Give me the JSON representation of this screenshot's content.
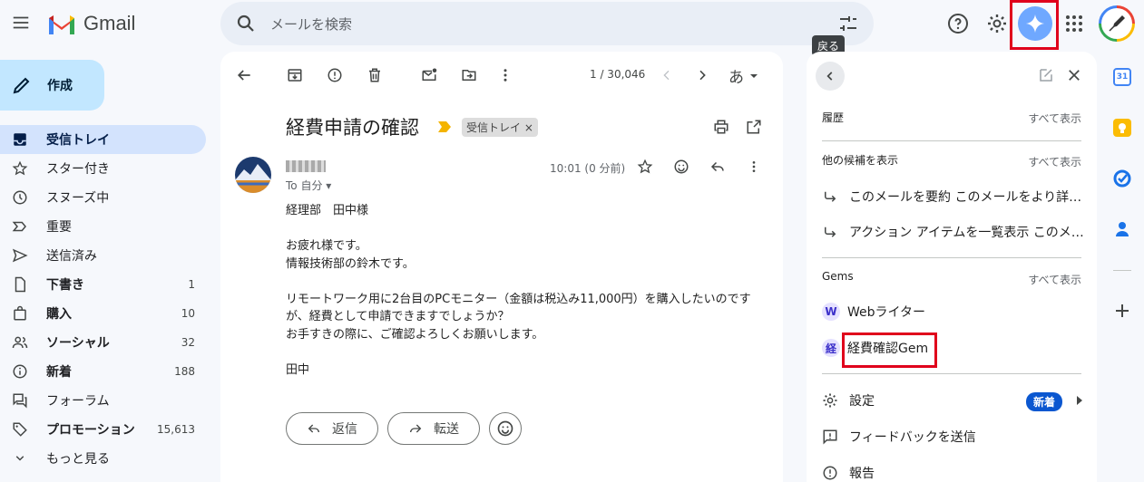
{
  "header": {
    "app_name": "Gmail",
    "search_placeholder": "メールを検索",
    "tooltip": "戻る"
  },
  "sidebar": {
    "compose_label": "作成",
    "items": [
      {
        "label": "受信トレイ",
        "count": "",
        "icon": "inbox-icon"
      },
      {
        "label": "スター付き",
        "count": "",
        "icon": "star-icon"
      },
      {
        "label": "スヌーズ中",
        "count": "",
        "icon": "clock-icon"
      },
      {
        "label": "重要",
        "count": "",
        "icon": "important-icon"
      },
      {
        "label": "送信済み",
        "count": "",
        "icon": "send-icon"
      },
      {
        "label": "下書き",
        "count": "1",
        "icon": "draft-icon"
      },
      {
        "label": "購入",
        "count": "10",
        "icon": "bag-icon"
      },
      {
        "label": "ソーシャル",
        "count": "32",
        "icon": "people-icon"
      },
      {
        "label": "新着",
        "count": "188",
        "icon": "info-icon"
      },
      {
        "label": "フォーラム",
        "count": "",
        "icon": "forum-icon"
      },
      {
        "label": "プロモーション",
        "count": "15,613",
        "icon": "tag-icon"
      },
      {
        "label": "もっと見る",
        "count": "",
        "icon": "chevron-down-icon"
      }
    ]
  },
  "mail": {
    "pager": "1 / 30,046",
    "input_tool": "あ",
    "subject": "経費申請の確認",
    "label_chip": "受信トレイ",
    "to": "To 自分",
    "time": "10:01 (0 分前)",
    "body": [
      "経理部　田中様",
      "",
      "お疲れ様です。",
      "情報技術部の鈴木です。",
      "",
      "リモートワーク用に2台目のPCモニター（金額は税込み11,000円）を購入したいのです",
      "が、経費として申請できますでしょうか？",
      "お手すきの際に、ご確認よろしくお願いします。",
      "",
      "田中"
    ],
    "reply_label": "返信",
    "forward_label": "転送"
  },
  "gemini": {
    "history_title": "履歴",
    "see_all": "すべて表示",
    "suggestions_title": "他の候補を表示",
    "suggestions": [
      "このメールを要約 このメールをより詳…",
      "アクション アイテムを一覧表示 このメ…"
    ],
    "gems_title": "Gems",
    "gems": [
      {
        "badge": "W",
        "label": "Webライター"
      },
      {
        "badge": "経",
        "label": "経費確認Gem"
      }
    ],
    "settings_label": "設定",
    "new_badge": "新着",
    "feedback_label": "フィードバックを送信",
    "report_label": "報告"
  },
  "colors": {
    "accent": "#0b57d0",
    "highlight": "#e0001b",
    "active_nav": "#d3e3fd"
  }
}
